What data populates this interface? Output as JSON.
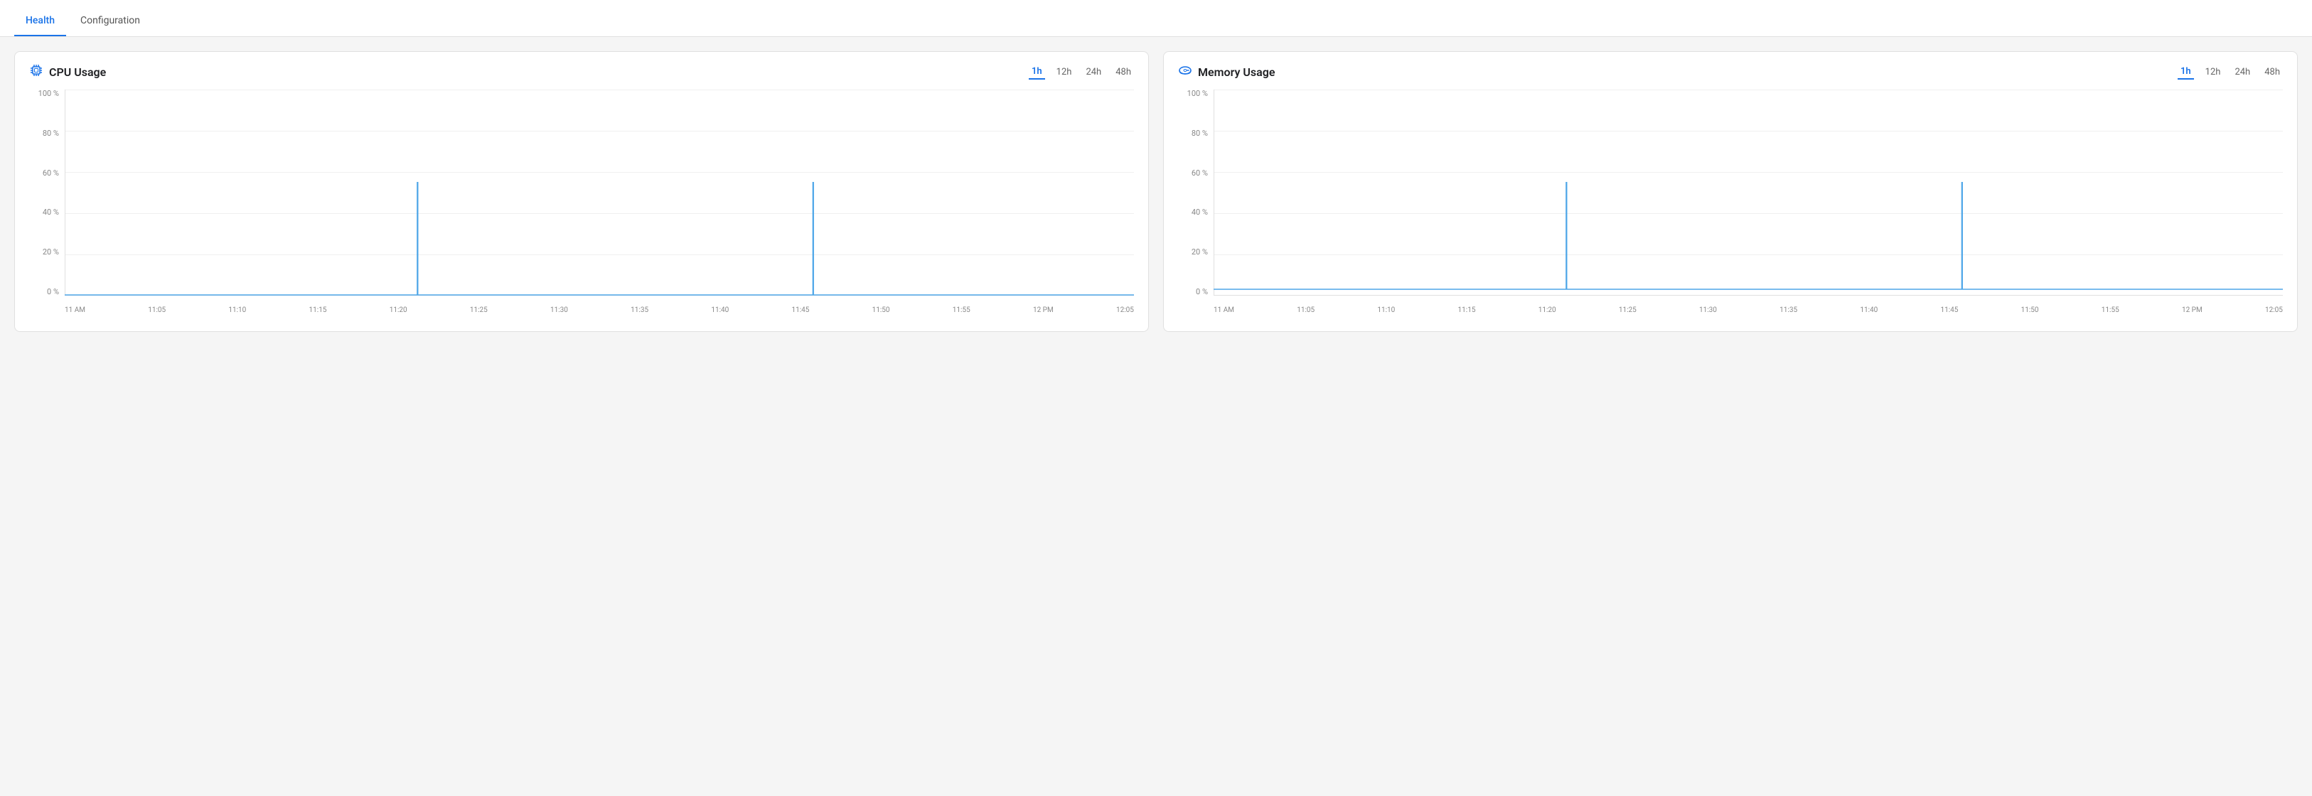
{
  "tabs": [
    {
      "id": "health",
      "label": "Health",
      "active": true
    },
    {
      "id": "configuration",
      "label": "Configuration",
      "active": false
    }
  ],
  "cpu_chart": {
    "title": "CPU Usage",
    "time_options": [
      "1h",
      "12h",
      "24h",
      "48h"
    ],
    "active_time": "1h",
    "y_labels": [
      "100 %",
      "80 %",
      "60 %",
      "40 %",
      "20 %",
      "0 %"
    ],
    "x_labels": [
      "11 AM",
      "11:05",
      "11:10",
      "11:15",
      "11:20",
      "11:25",
      "11:30",
      "11:35",
      "11:40",
      "11:45",
      "11:50",
      "11:55",
      "12 PM",
      "12:05"
    ],
    "spikes": [
      {
        "x_pct": 33,
        "height_pct": 55
      },
      {
        "x_pct": 70,
        "height_pct": 55
      }
    ]
  },
  "memory_chart": {
    "title": "Memory Usage",
    "time_options": [
      "1h",
      "12h",
      "24h",
      "48h"
    ],
    "active_time": "1h",
    "y_labels": [
      "100 %",
      "80 %",
      "60 %",
      "40 %",
      "20 %",
      "0 %"
    ],
    "x_labels": [
      "11 AM",
      "11:05",
      "11:10",
      "11:15",
      "11:20",
      "11:25",
      "11:30",
      "11:35",
      "11:40",
      "11:45",
      "11:50",
      "11:55",
      "12 PM",
      "12:05"
    ],
    "spikes": [
      {
        "x_pct": 33,
        "height_pct": 55
      },
      {
        "x_pct": 70,
        "height_pct": 55
      }
    ],
    "baseline_pct": 3
  },
  "colors": {
    "accent": "#1a73e8",
    "chart_line": "#4da6e8",
    "grid": "#f0f0f0",
    "axis": "#e0e0e0"
  }
}
